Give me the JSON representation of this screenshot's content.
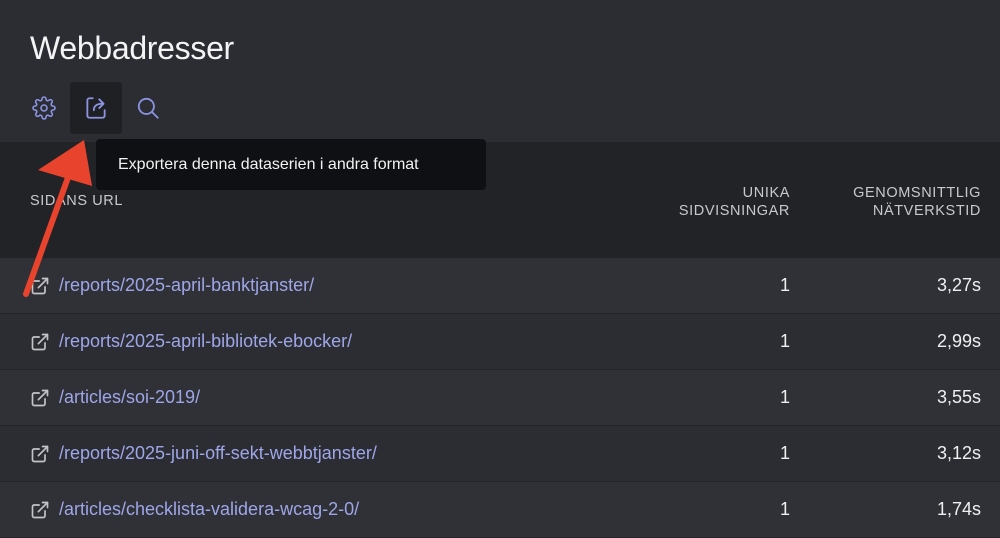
{
  "page": {
    "title": "Webbadresser"
  },
  "toolbar": {
    "settings_icon": "gear-icon",
    "export_icon": "export-icon",
    "search_icon": "search-icon",
    "accent_color": "#8b93e0"
  },
  "tooltip": {
    "text": "Exportera denna dataserien i andra format"
  },
  "table": {
    "columns": {
      "url": "SIDANS URL",
      "views_line1": "UNIKA",
      "views_line2": "SIDVISNINGAR",
      "net_line1": "GENOMSNITTLIG",
      "net_line2": "NÄTVERKSTID"
    },
    "rows": [
      {
        "url": "/reports/2025-april-banktjanster/",
        "views": "1",
        "net": "3,27s"
      },
      {
        "url": "/reports/2025-april-bibliotek-ebocker/",
        "views": "1",
        "net": "2,99s"
      },
      {
        "url": "/articles/soi-2019/",
        "views": "1",
        "net": "3,55s"
      },
      {
        "url": "/reports/2025-juni-off-sekt-webbtjanster/",
        "views": "1",
        "net": "3,12s"
      },
      {
        "url": "/articles/checklista-validera-wcag-2-0/",
        "views": "1",
        "net": "1,74s"
      }
    ]
  },
  "annotation": {
    "arrow_color": "#e8432d"
  }
}
